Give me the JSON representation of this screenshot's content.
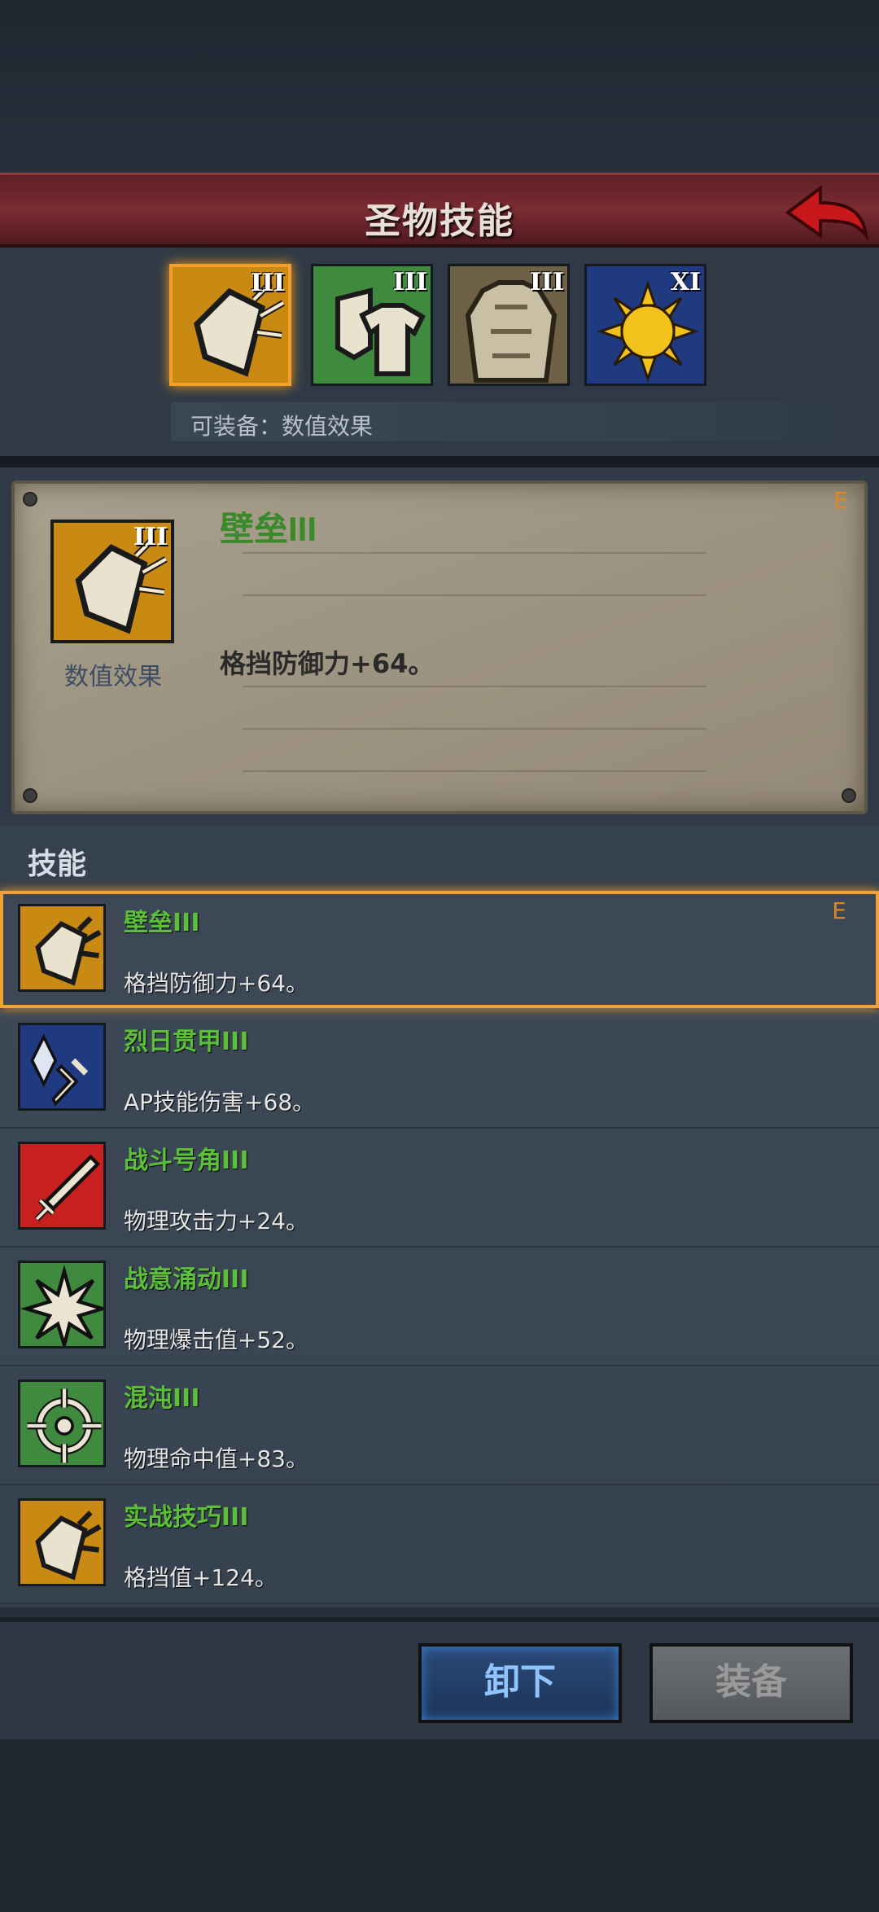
{
  "header": {
    "title": "圣物技能"
  },
  "relics": [
    {
      "tier": "III",
      "icon": "shield-fragments-icon",
      "color": "#d79a1a"
    },
    {
      "tier": "III",
      "icon": "shield-shirt-icon",
      "color": "#3f8a3f"
    },
    {
      "tier": "III",
      "icon": "armor-icon",
      "color": "#b89a5a"
    },
    {
      "tier": "XI",
      "icon": "sun-icon",
      "color": "#1f3a80"
    }
  ],
  "equip_note": "可装备：数值效果",
  "detail": {
    "tier": "III",
    "caption": "数值效果",
    "name": "壁垒III",
    "badge": "E",
    "description": "格挡防御力+64。"
  },
  "skills_header": "技能",
  "skills": [
    {
      "name": "壁垒III",
      "desc": "格挡防御力+64。",
      "badge": "E",
      "icon": "shield-fragments-icon",
      "color": "#d79a1a"
    },
    {
      "name": "烈日贯甲III",
      "desc": "AP技能伤害+68。",
      "badge": "",
      "icon": "crystal-sword-icon",
      "color": "#1f3a80"
    },
    {
      "name": "战斗号角III",
      "desc": "物理攻击力+24。",
      "badge": "",
      "icon": "sword-icon",
      "color": "#c6201f"
    },
    {
      "name": "战意涌动III",
      "desc": "物理爆击值+52。",
      "badge": "",
      "icon": "burst-icon",
      "color": "#3f8a3f"
    },
    {
      "name": "混沌III",
      "desc": "物理命中值+83。",
      "badge": "",
      "icon": "crosshair-icon",
      "color": "#3f8a3f"
    },
    {
      "name": "实战技巧III",
      "desc": "格挡值+124。",
      "badge": "",
      "icon": "shield-fragments-icon",
      "color": "#d79a1a"
    }
  ],
  "actions": {
    "unequip": "卸下",
    "equip": "装备"
  }
}
